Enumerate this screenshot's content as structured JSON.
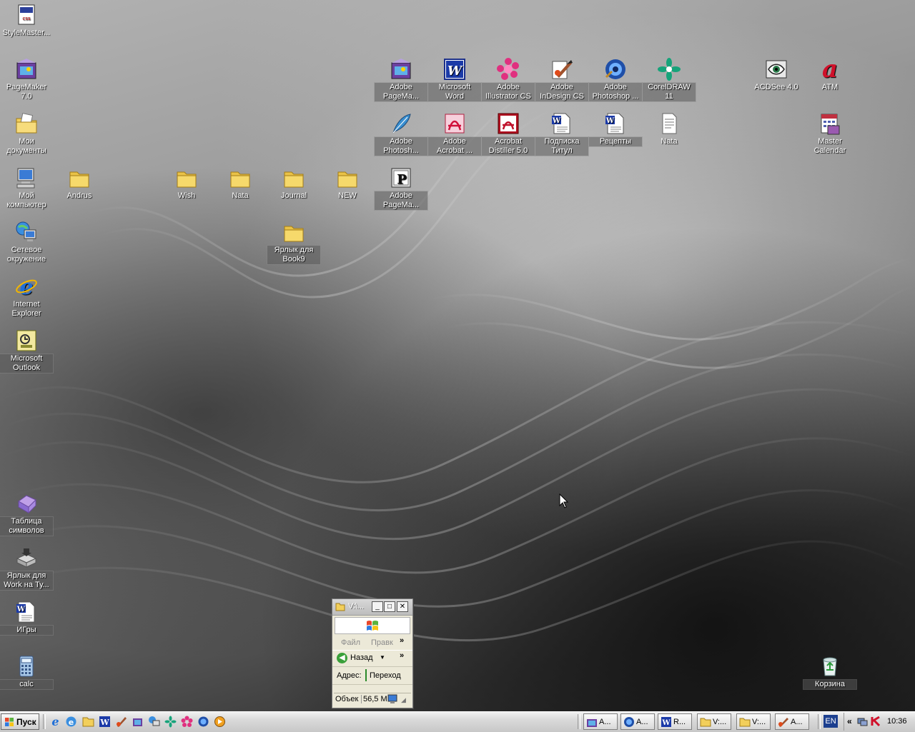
{
  "desktop": {
    "icons": [
      {
        "name": "stylemaster",
        "label": "StyleMaster...",
        "icon": "stylemaster-icon"
      },
      {
        "name": "pagemaker7",
        "label": "PageMaker 7.0",
        "icon": "pagemaker-icon"
      },
      {
        "name": "my-documents",
        "label": "Мои документы",
        "icon": "documents-folder-icon"
      },
      {
        "name": "my-computer",
        "label": "Мой компьютер",
        "icon": "computer-icon"
      },
      {
        "name": "network",
        "label": "Сетевое окружение",
        "icon": "network-icon"
      },
      {
        "name": "internet-explorer",
        "label": "Internet Explorer",
        "icon": "ie-icon"
      },
      {
        "name": "outlook",
        "label": "Microsoft Outlook",
        "icon": "outlook-icon"
      },
      {
        "name": "andrus",
        "label": "Andrus",
        "icon": "folder-icon"
      },
      {
        "name": "wish",
        "label": "Wish",
        "icon": "folder-icon"
      },
      {
        "name": "nata-folder",
        "label": "Nata",
        "icon": "folder-icon"
      },
      {
        "name": "journal",
        "label": "Journal",
        "icon": "folder-icon"
      },
      {
        "name": "new",
        "label": "NEW",
        "icon": "folder-icon"
      },
      {
        "name": "book9",
        "label": "Ярлык для Book9",
        "icon": "folder-icon"
      },
      {
        "name": "adobe-pagemaker-1",
        "label": "Adobe PageMa...",
        "icon": "pagemaker-icon"
      },
      {
        "name": "ms-word",
        "label": "Microsoft Word",
        "icon": "word-icon"
      },
      {
        "name": "illustrator",
        "label": "Adobe Illustrator CS",
        "icon": "illustrator-icon"
      },
      {
        "name": "indesign",
        "label": "Adobe InDesign CS",
        "icon": "indesign-icon"
      },
      {
        "name": "photoshop",
        "label": "Adobe Photoshop ...",
        "icon": "photoshop-icon"
      },
      {
        "name": "coreldraw",
        "label": "CorelDRAW 11",
        "icon": "coreldraw-icon"
      },
      {
        "name": "photoshop2",
        "label": "Adobe Photosh...",
        "icon": "feather-icon"
      },
      {
        "name": "acrobat",
        "label": "Adobe Acrobat ...",
        "icon": "acrobat-icon"
      },
      {
        "name": "distiller",
        "label": "Acrobat Distiller 5.0",
        "icon": "distiller-icon"
      },
      {
        "name": "podpiska",
        "label": "Подписка Титул",
        "icon": "word-doc-icon"
      },
      {
        "name": "recepty",
        "label": "Рецепты",
        "icon": "word-doc-icon"
      },
      {
        "name": "nata-doc",
        "label": "Nata",
        "icon": "text-doc-icon"
      },
      {
        "name": "adobe-pagemaker-2",
        "label": "Adobe PageMa...",
        "icon": "pagemaker-plugin-icon"
      },
      {
        "name": "acdsee",
        "label": "ACDSee 4.0",
        "icon": "acdsee-eye-icon"
      },
      {
        "name": "atm",
        "label": "ATM",
        "icon": "atm-icon"
      },
      {
        "name": "master-calendar",
        "label": "Master Calendar",
        "icon": "calendar-icon"
      },
      {
        "name": "charmap",
        "label": "Таблица символов",
        "icon": "charmap-icon"
      },
      {
        "name": "work-shortcut",
        "label": "Ярлык для Work на Ту...",
        "icon": "drive-icon"
      },
      {
        "name": "igry",
        "label": "ИГры",
        "icon": "word-doc-icon"
      },
      {
        "name": "calc",
        "label": "calc",
        "icon": "calculator-icon"
      },
      {
        "name": "recycle-bin",
        "label": "Корзина",
        "icon": "recycle-bin-icon"
      }
    ]
  },
  "mini_window": {
    "title": "V:\\...",
    "menu": {
      "file": "Файл",
      "edit": "Правк",
      "more": "»"
    },
    "nav": {
      "back": "Назад",
      "more": "»"
    },
    "address": {
      "label": "Адрес:",
      "go": "Переход"
    },
    "status": {
      "objects": "Объек",
      "size": "56,5 M"
    }
  },
  "taskbar": {
    "start_label": "Пуск",
    "quick_launch": [
      "ie-icon",
      "outlook-express-icon",
      "folder-icon",
      "word-icon",
      "indesign-icon",
      "pagemaker-icon",
      "network-icon",
      "coreldraw-icon",
      "illustrator-icon",
      "photoshop-icon",
      "media-player-icon"
    ],
    "tasks": [
      {
        "label": "A...",
        "icon": "pagemaker-icon"
      },
      {
        "label": "A...",
        "icon": "photoshop-icon"
      },
      {
        "label": "R...",
        "icon": "word-icon"
      },
      {
        "label": "V:...",
        "icon": "folder-icon"
      },
      {
        "label": "V:...",
        "icon": "folder-icon"
      },
      {
        "label": "A...",
        "icon": "indesign-icon"
      }
    ],
    "language": "EN",
    "tray_arrow": "«",
    "clock": "10:36"
  }
}
